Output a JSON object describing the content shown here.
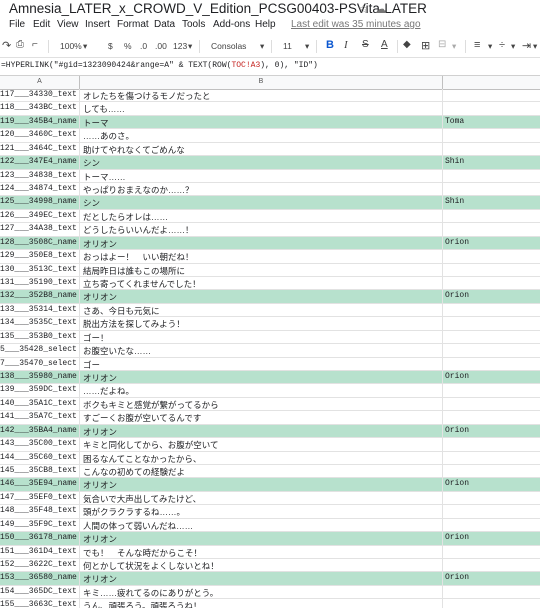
{
  "title": "Amnesia_LATER_x_CROWD_V_Edition_PCSG00403-PSVita-LATER",
  "menu": [
    "File",
    "Edit",
    "View",
    "Insert",
    "Format",
    "Data",
    "Tools",
    "Add-ons",
    "Help"
  ],
  "last_edit": "Last edit was 35 minutes ago",
  "toolbar": {
    "zoom": "100%",
    "currency": "$",
    "percent": "%",
    "dec_less": ".0",
    "dec_more": ".00",
    "more_formats": "123",
    "font": "Consolas",
    "font_size": "11",
    "bold": "B",
    "italic": "I",
    "strike": "S",
    "text_color": "A"
  },
  "formula": {
    "prefix": "=HYPERLINK(\"#gid=1323090424&range=A\" & TEXT(ROW(",
    "ref": "TOC!A3",
    "suffix": "), 0), \"ID\")"
  },
  "columns": [
    "A",
    "B"
  ],
  "rows": [
    {
      "a": "117___34330_text",
      "b": "オレたちを傷つけるモノだったと",
      "c": "",
      "hl": false
    },
    {
      "a": "118___343BC_text",
      "b": "しても……",
      "c": "",
      "hl": false
    },
    {
      "a": "119___345B4_name",
      "b": "トーマ",
      "c": "Toma",
      "hl": true
    },
    {
      "a": "120___3460C_text",
      "b": "……あのさ。",
      "c": "",
      "hl": false
    },
    {
      "a": "121___3464C_text",
      "b": "助けてやれなくてごめんな",
      "c": "",
      "hl": false
    },
    {
      "a": "122___347E4_name",
      "b": "シン",
      "c": "Shin",
      "hl": true
    },
    {
      "a": "123___34838_text",
      "b": "トーマ……",
      "c": "",
      "hl": false
    },
    {
      "a": "124___34874_text",
      "b": "やっぱりおまえなのか……？",
      "c": "",
      "hl": false
    },
    {
      "a": "125___34998_name",
      "b": "シン",
      "c": "Shin",
      "hl": true
    },
    {
      "a": "126___349EC_text",
      "b": "だとしたらオレは……",
      "c": "",
      "hl": false
    },
    {
      "a": "127___34A38_text",
      "b": "どうしたらいいんだよ……！",
      "c": "",
      "hl": false
    },
    {
      "a": "128___3508C_name",
      "b": "オリオン",
      "c": "Orion",
      "hl": true
    },
    {
      "a": "129___350E8_text",
      "b": "おっはよー！　いい朝だね！",
      "c": "",
      "hl": false
    },
    {
      "a": "130___3513C_text",
      "b": "結局昨日は誰もこの場所に",
      "c": "",
      "hl": false
    },
    {
      "a": "131___35190_text",
      "b": "立ち寄ってくれませんでした！",
      "c": "",
      "hl": false
    },
    {
      "a": "132___352B8_name",
      "b": "オリオン",
      "c": "Orion",
      "hl": true
    },
    {
      "a": "133___35314_text",
      "b": "さあ、今日も元気に",
      "c": "",
      "hl": false
    },
    {
      "a": "134___3535C_text",
      "b": "脱出方法を探してみよう！",
      "c": "",
      "hl": false
    },
    {
      "a": "135___353B0_text",
      "b": "ゴー！",
      "c": "",
      "hl": false
    },
    {
      "a": "5___35428_select",
      "b": "お腹空いたな……",
      "c": "",
      "hl": false
    },
    {
      "a": "7___35470_select",
      "b": "ゴー",
      "c": "",
      "hl": false
    },
    {
      "a": "138___35980_name",
      "b": "オリオン",
      "c": "Orion",
      "hl": true
    },
    {
      "a": "139___359DC_text",
      "b": "……だよね。",
      "c": "",
      "hl": false
    },
    {
      "a": "140___35A1C_text",
      "b": "ボクもキミと感覚が繋がってるから",
      "c": "",
      "hl": false
    },
    {
      "a": "141___35A7C_text",
      "b": "すごーくお腹が空いてるんです",
      "c": "",
      "hl": false
    },
    {
      "a": "142___35BA4_name",
      "b": "オリオン",
      "c": "Orion",
      "hl": true
    },
    {
      "a": "143___35C00_text",
      "b": "キミと同化してから、お腹が空いて",
      "c": "",
      "hl": false
    },
    {
      "a": "144___35C60_text",
      "b": "困るなんてことなかったから、",
      "c": "",
      "hl": false
    },
    {
      "a": "145___35CB8_text",
      "b": "こんなの初めての経験だよ",
      "c": "",
      "hl": false
    },
    {
      "a": "146___35E94_name",
      "b": "オリオン",
      "c": "Orion",
      "hl": true
    },
    {
      "a": "147___35EF0_text",
      "b": "気合いで大声出してみたけど、",
      "c": "",
      "hl": false
    },
    {
      "a": "148___35F48_text",
      "b": "頭がクラクラするね……。",
      "c": "",
      "hl": false
    },
    {
      "a": "149___35F9C_text",
      "b": "人間の体って弱いんだね……",
      "c": "",
      "hl": false
    },
    {
      "a": "150___36178_name",
      "b": "オリオン",
      "c": "Orion",
      "hl": true
    },
    {
      "a": "151___361D4_text",
      "b": "でも！　そんな時だからこそ！",
      "c": "",
      "hl": false
    },
    {
      "a": "152___3622C_text",
      "b": "何とかして状況をよくしないとね！",
      "c": "",
      "hl": false
    },
    {
      "a": "153___36580_name",
      "b": "オリオン",
      "c": "Orion",
      "hl": true
    },
    {
      "a": "154___365DC_text",
      "b": "キミ……疲れてるのにありがとう。",
      "c": "",
      "hl": false
    },
    {
      "a": "155___3663C_text",
      "b": "うん、頑張ろう。頑張ろうね！",
      "c": "",
      "hl": false
    }
  ]
}
